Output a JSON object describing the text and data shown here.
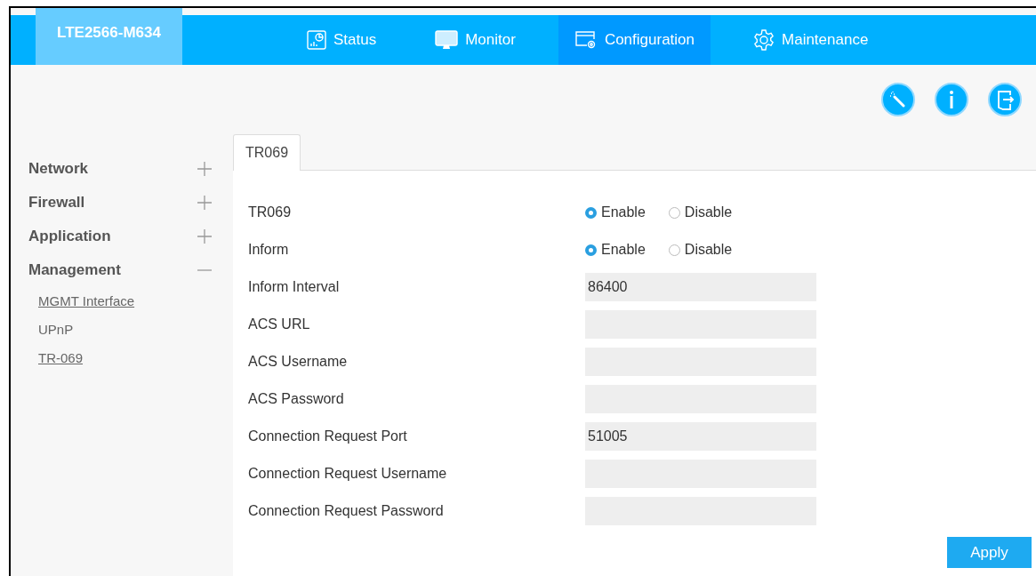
{
  "header": {
    "logo": "LTE2566-M634",
    "nav": [
      {
        "label": "Status",
        "kind": "status",
        "selected": false
      },
      {
        "label": "Monitor",
        "kind": "monitor",
        "selected": false
      },
      {
        "label": "Configuration",
        "kind": "config",
        "selected": true
      },
      {
        "label": "Maintenance",
        "kind": "gear",
        "selected": false
      }
    ]
  },
  "sidebar": {
    "items": [
      {
        "label": "Network",
        "expanded": false
      },
      {
        "label": "Firewall",
        "expanded": false
      },
      {
        "label": "Application",
        "expanded": false
      },
      {
        "label": "Management",
        "expanded": true,
        "children": [
          {
            "label": "MGMT Interface",
            "visited": true
          },
          {
            "label": "UPnP",
            "visited": false
          },
          {
            "label": "TR-069",
            "visited": true
          }
        ]
      }
    ]
  },
  "tabs": [
    {
      "label": "TR069",
      "selected": true
    }
  ],
  "fields": [
    {
      "kind": "radio",
      "label": "TR069",
      "options": [
        {
          "label": "Enable",
          "selected": true
        },
        {
          "label": "Disable",
          "selected": false
        }
      ]
    },
    {
      "kind": "radio",
      "label": "Inform",
      "options": [
        {
          "label": "Enable",
          "selected": true
        },
        {
          "label": "Disable",
          "selected": false
        }
      ]
    },
    {
      "kind": "text",
      "label": "Inform Interval",
      "value": "86400"
    },
    {
      "kind": "text",
      "label": "ACS URL"
    },
    {
      "kind": "text",
      "label": "ACS Username"
    },
    {
      "kind": "text",
      "label": "ACS Password"
    },
    {
      "kind": "text",
      "label": "Connection Request Port",
      "value": "51005"
    },
    {
      "kind": "text",
      "label": "Connection Request Username"
    },
    {
      "kind": "text",
      "label": "Connection Request Password"
    }
  ],
  "buttons": [
    "Apply"
  ]
}
